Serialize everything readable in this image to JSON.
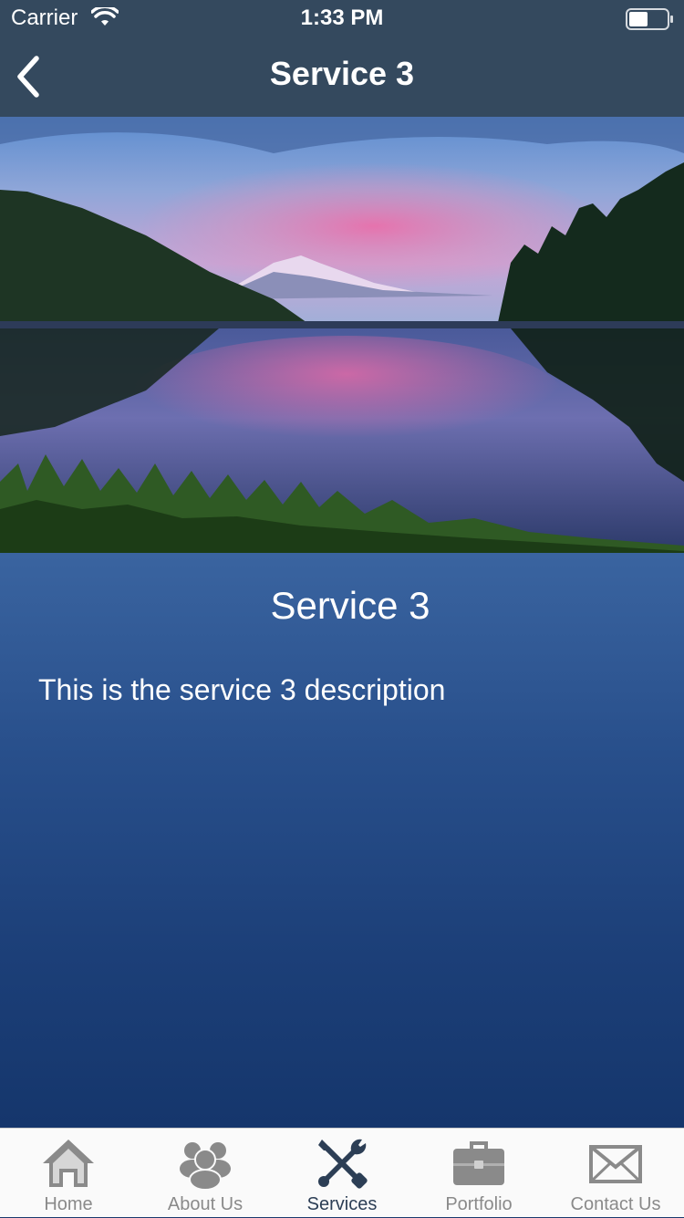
{
  "status_bar": {
    "carrier": "Carrier",
    "time": "1:33 PM",
    "battery_level": 0.5
  },
  "nav": {
    "title": "Service 3",
    "back_icon": "chevron-left-icon"
  },
  "hero": {
    "image": "mountain-lake-sunset"
  },
  "content": {
    "title": "Service 3",
    "description": "This is the service 3 description"
  },
  "tabs": [
    {
      "label": "Home",
      "icon": "home-icon",
      "active": false
    },
    {
      "label": "About Us",
      "icon": "people-icon",
      "active": false
    },
    {
      "label": "Services",
      "icon": "tools-icon",
      "active": true
    },
    {
      "label": "Portfolio",
      "icon": "briefcase-icon",
      "active": false
    },
    {
      "label": "Contact Us",
      "icon": "envelope-icon",
      "active": false
    }
  ],
  "colors": {
    "header": "#34495e",
    "content_top": "#3a64a0",
    "content_bottom": "#15366c",
    "tab_active": "#2c3e55",
    "tab_inactive": "#8a8a8a"
  }
}
